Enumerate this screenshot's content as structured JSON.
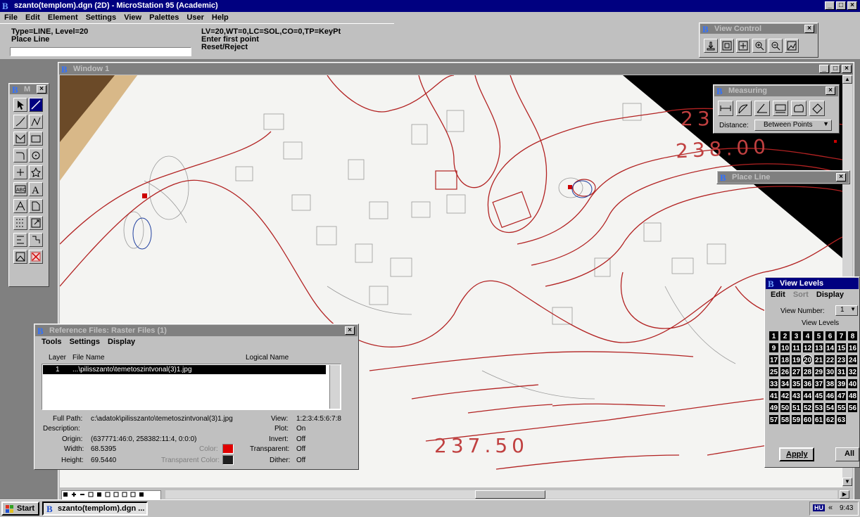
{
  "app": {
    "title": "szanto(templom).dgn (2D) - MicroStation 95 (Academic)",
    "menu": [
      "File",
      "Edit",
      "Element",
      "Settings",
      "View",
      "Palettes",
      "User",
      "Help"
    ],
    "status": {
      "left1": "Type=LINE, Level=20",
      "left2": "Place Line",
      "right1": "LV=20,WT=0,LC=SOL,CO=0,TP=KeyPt",
      "right2": "Enter first point",
      "right3": "Reset/Reject"
    }
  },
  "view_control": {
    "title": "View Control"
  },
  "window1": {
    "title": "Window 1"
  },
  "main_palette": {
    "title": "M"
  },
  "measuring": {
    "title": "Measuring",
    "distance_label": "Distance:",
    "distance_value": "Between Points"
  },
  "place_line": {
    "title": "Place Line"
  },
  "drawing": {
    "label_a": "238.00",
    "label_b": "237.50",
    "label_c": "23"
  },
  "reference_files": {
    "title": "Reference Files: Raster Files (1)",
    "menu": [
      "Tools",
      "Settings",
      "Display"
    ],
    "columns": {
      "layer": "Layer",
      "file": "File Name",
      "logical": "Logical Name"
    },
    "rows": [
      {
        "layer": "1",
        "file": "...\\pilisszanto\\temetoszintvonal(3)1.jpg"
      }
    ],
    "full_path_label": "Full Path:",
    "full_path": "c:\\adatok\\pilisszanto\\temetoszintvonal(3)1.jpg",
    "description_label": "Description:",
    "origin_label": "Origin:",
    "origin": "(637771:46:0, 258382:11:4, 0:0:0)",
    "width_label": "Width:",
    "width": "68.5395",
    "height_label": "Height:",
    "height": "69.5440",
    "color_label": "Color:",
    "transparent_color_label": "Transparent Color:",
    "view_label": "View:",
    "view": "1:2:3:4:5:6:7:8",
    "plot_label": "Plot:",
    "plot": "On",
    "invert_label": "Invert:",
    "invert": "Off",
    "transparent_label": "Transparent:",
    "transparent": "Off",
    "dither_label": "Dither:",
    "dither": "Off",
    "color_hex": "#e00000",
    "transparent_color_hex": "#202020"
  },
  "view_levels": {
    "title": "View Levels",
    "menu": [
      "Edit",
      "Sort",
      "Display"
    ],
    "view_number_label": "View Number:",
    "view_number": "1",
    "levels_label": "View Levels",
    "levels": [
      "1",
      "2",
      "3",
      "4",
      "5",
      "6",
      "7",
      "8",
      "9",
      "10",
      "11",
      "12",
      "13",
      "14",
      "15",
      "16",
      "17",
      "18",
      "19",
      "20",
      "21",
      "22",
      "23",
      "24",
      "25",
      "26",
      "27",
      "28",
      "29",
      "30",
      "31",
      "32",
      "33",
      "34",
      "35",
      "36",
      "37",
      "38",
      "39",
      "40",
      "41",
      "42",
      "43",
      "44",
      "45",
      "46",
      "47",
      "48",
      "49",
      "50",
      "51",
      "52",
      "53",
      "54",
      "55",
      "56",
      "57",
      "58",
      "59",
      "60",
      "61",
      "62",
      "63"
    ],
    "apply": "Apply",
    "all": "All"
  },
  "taskbar": {
    "start": "Start",
    "task": "szanto(templom).dgn ...",
    "lang": "HU",
    "arrows": "«",
    "time": "9:43"
  }
}
